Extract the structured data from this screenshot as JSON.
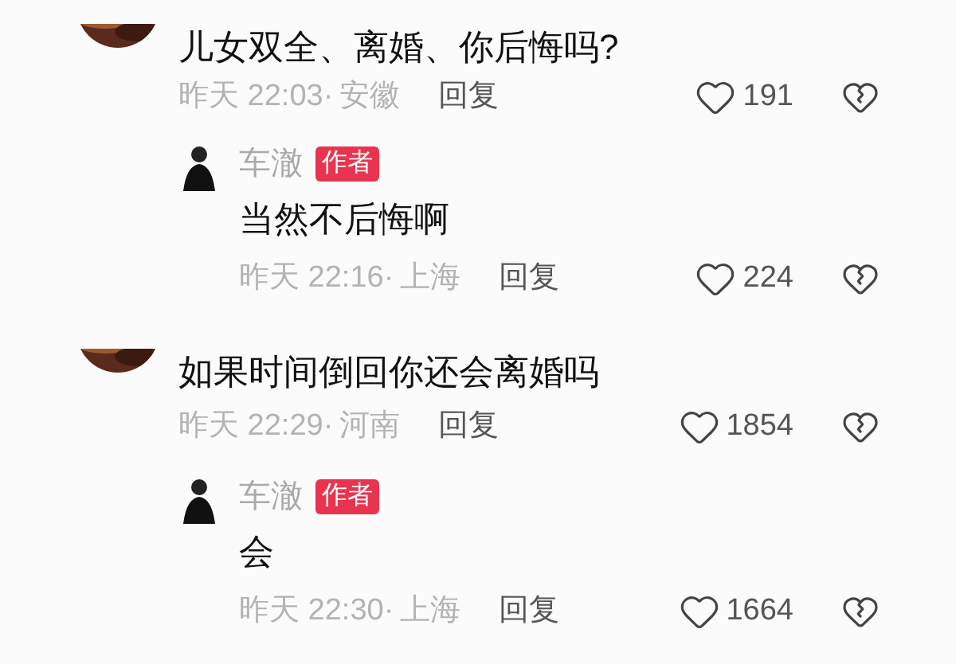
{
  "comments": [
    {
      "text": "儿女双全、离婚、你后悔吗?",
      "time": "昨天 22:03·",
      "location": "安徽",
      "reply_label": "回复",
      "likes": "191",
      "replies": [
        {
          "name": "车澈",
          "tag": "作者",
          "text": "当然不后悔啊",
          "time": "昨天 22:16·",
          "location": "上海",
          "reply_label": "回复",
          "likes": "224"
        }
      ]
    },
    {
      "text": "如果时间倒回你还会离婚吗",
      "time": "昨天 22:29·",
      "location": "河南",
      "reply_label": "回复",
      "likes": "1854",
      "replies": [
        {
          "name": "车澈",
          "tag": "作者",
          "text": "会",
          "time": "昨天 22:30·",
          "location": "上海",
          "reply_label": "回复",
          "likes": "1664"
        }
      ]
    }
  ]
}
